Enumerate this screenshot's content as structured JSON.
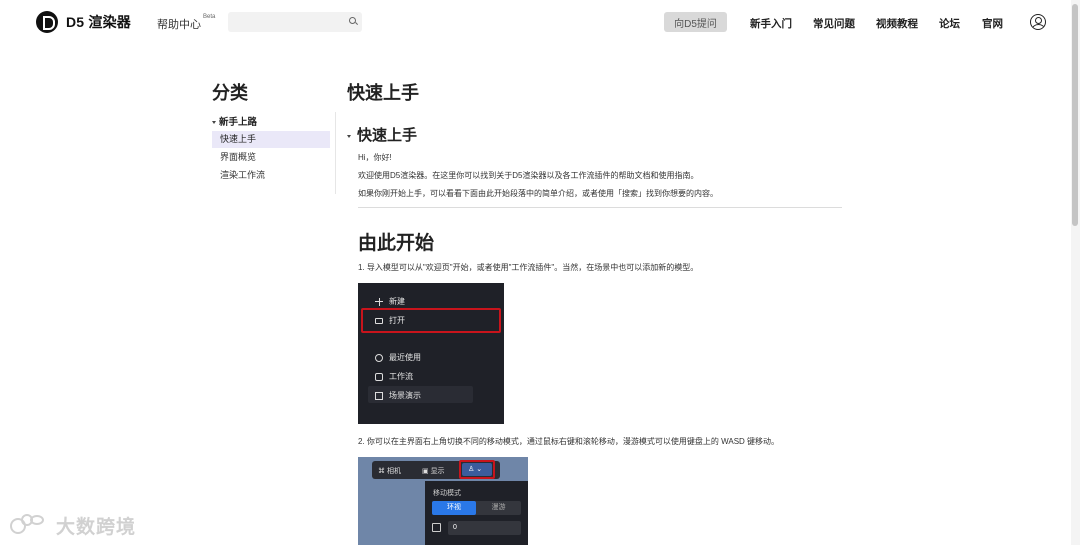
{
  "header": {
    "logo_text": "D5 渲染器",
    "help_center": "帮助中心",
    "beta": "Beta",
    "search_placeholder": "",
    "ask_button": "向D5提问",
    "links": [
      "新手入门",
      "常见问题",
      "视频教程",
      "论坛",
      "官网"
    ]
  },
  "sidebar": {
    "title": "分类",
    "group": "新手上路",
    "items": [
      {
        "label": "快速上手",
        "active": true
      },
      {
        "label": "界面概览",
        "active": false
      },
      {
        "label": "渲染工作流",
        "active": false
      }
    ]
  },
  "main": {
    "title": "快速上手",
    "section_title": "快速上手",
    "greeting": "Hi，你好!",
    "intro_1": "欢迎使用D5渲染器。在这里你可以找到关于D5渲染器以及各工作流插件的帮助文档和使用指南。",
    "intro_2": "如果你刚开始上手，可以看看下面由此开始段落中的简单介绍，或者使用「搜索」找到你想要的内容。",
    "h2": "由此开始",
    "step_1": "1. 导入模型可以从\"欢迎页\"开始，或者使用\"工作流插件\"。当然，在场景中也可以添加新的模型。",
    "step_2": "2. 你可以在主界面右上角切换不同的移动模式，通过鼠标右键和滚轮移动，漫游模式可以使用键盘上的 WASD 键移动。"
  },
  "screenshot1": {
    "new": "新建",
    "open": "打开",
    "recent": "最近使用",
    "workflow": "工作流",
    "scene_demo": "场景演示"
  },
  "screenshot2": {
    "camera": "相机",
    "display": "显示",
    "move_mode": "移动模式",
    "orbit": "环视",
    "roam": "漫游",
    "speed_value": "0"
  },
  "watermark": {
    "text": "大数跨境"
  }
}
